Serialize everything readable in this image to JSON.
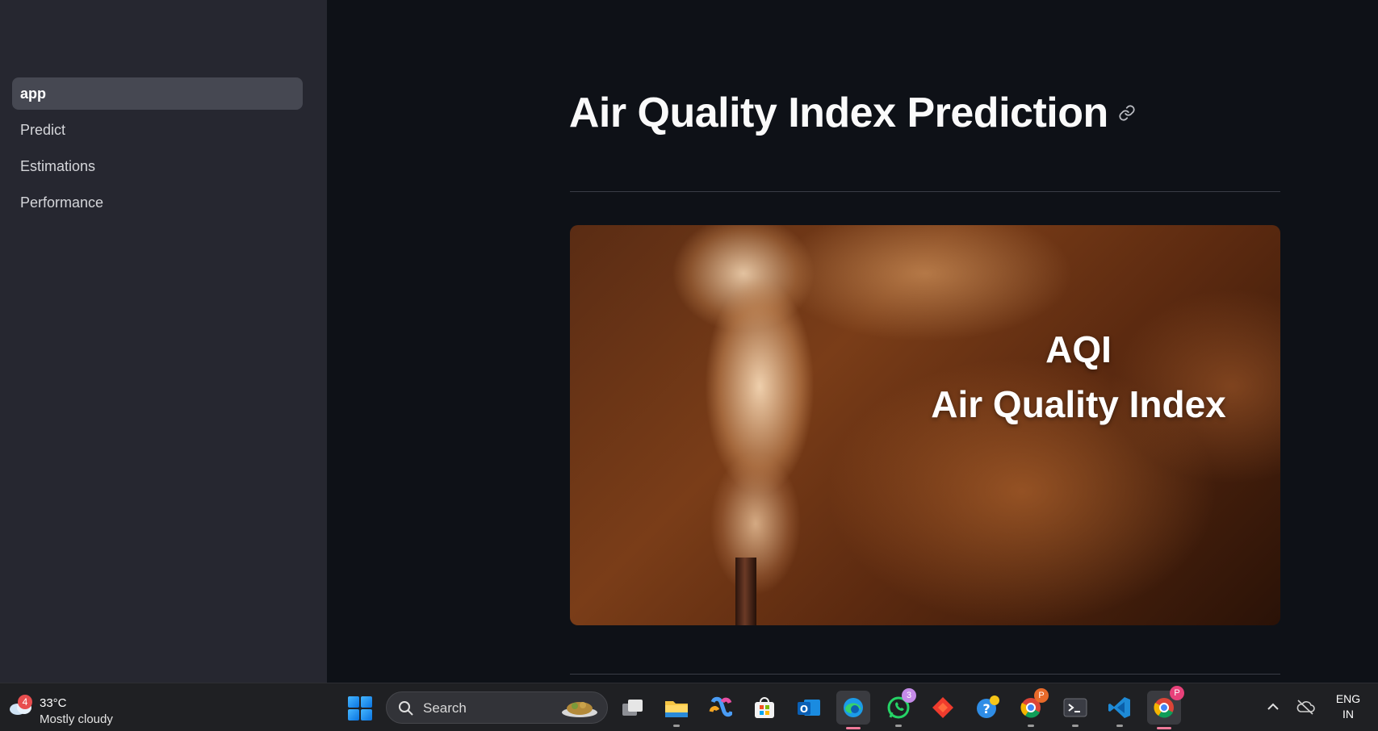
{
  "sidebar": {
    "items": [
      {
        "label": "app",
        "active": true
      },
      {
        "label": "Predict",
        "active": false
      },
      {
        "label": "Estimations",
        "active": false
      },
      {
        "label": "Performance",
        "active": false
      }
    ]
  },
  "main": {
    "title": "Air Quality Index Prediction",
    "hero": {
      "line1": "AQI",
      "line2": "Air Quality Index"
    }
  },
  "taskbar": {
    "weather": {
      "badge": "4",
      "temp": "33°C",
      "desc": "Mostly cloudy"
    },
    "search": {
      "placeholder": "Search"
    },
    "apps": [
      {
        "name": "task-view-icon"
      },
      {
        "name": "file-explorer-icon"
      },
      {
        "name": "copilot-icon"
      },
      {
        "name": "microsoft-store-icon"
      },
      {
        "name": "outlook-icon"
      },
      {
        "name": "edge-icon"
      },
      {
        "name": "whatsapp-icon",
        "badge": "3"
      },
      {
        "name": "anydesk-icon"
      },
      {
        "name": "help-icon"
      },
      {
        "name": "chrome-icon",
        "badge": "P"
      },
      {
        "name": "terminal-icon"
      },
      {
        "name": "vscode-icon"
      },
      {
        "name": "chrome-profile-icon",
        "badge": "P"
      }
    ],
    "lang": {
      "line1": "ENG",
      "line2": "IN"
    }
  },
  "colors": {
    "background": "#0e1117",
    "sidebar": "#262730",
    "active_nav": "#464852",
    "taskbar": "#1f2023"
  }
}
